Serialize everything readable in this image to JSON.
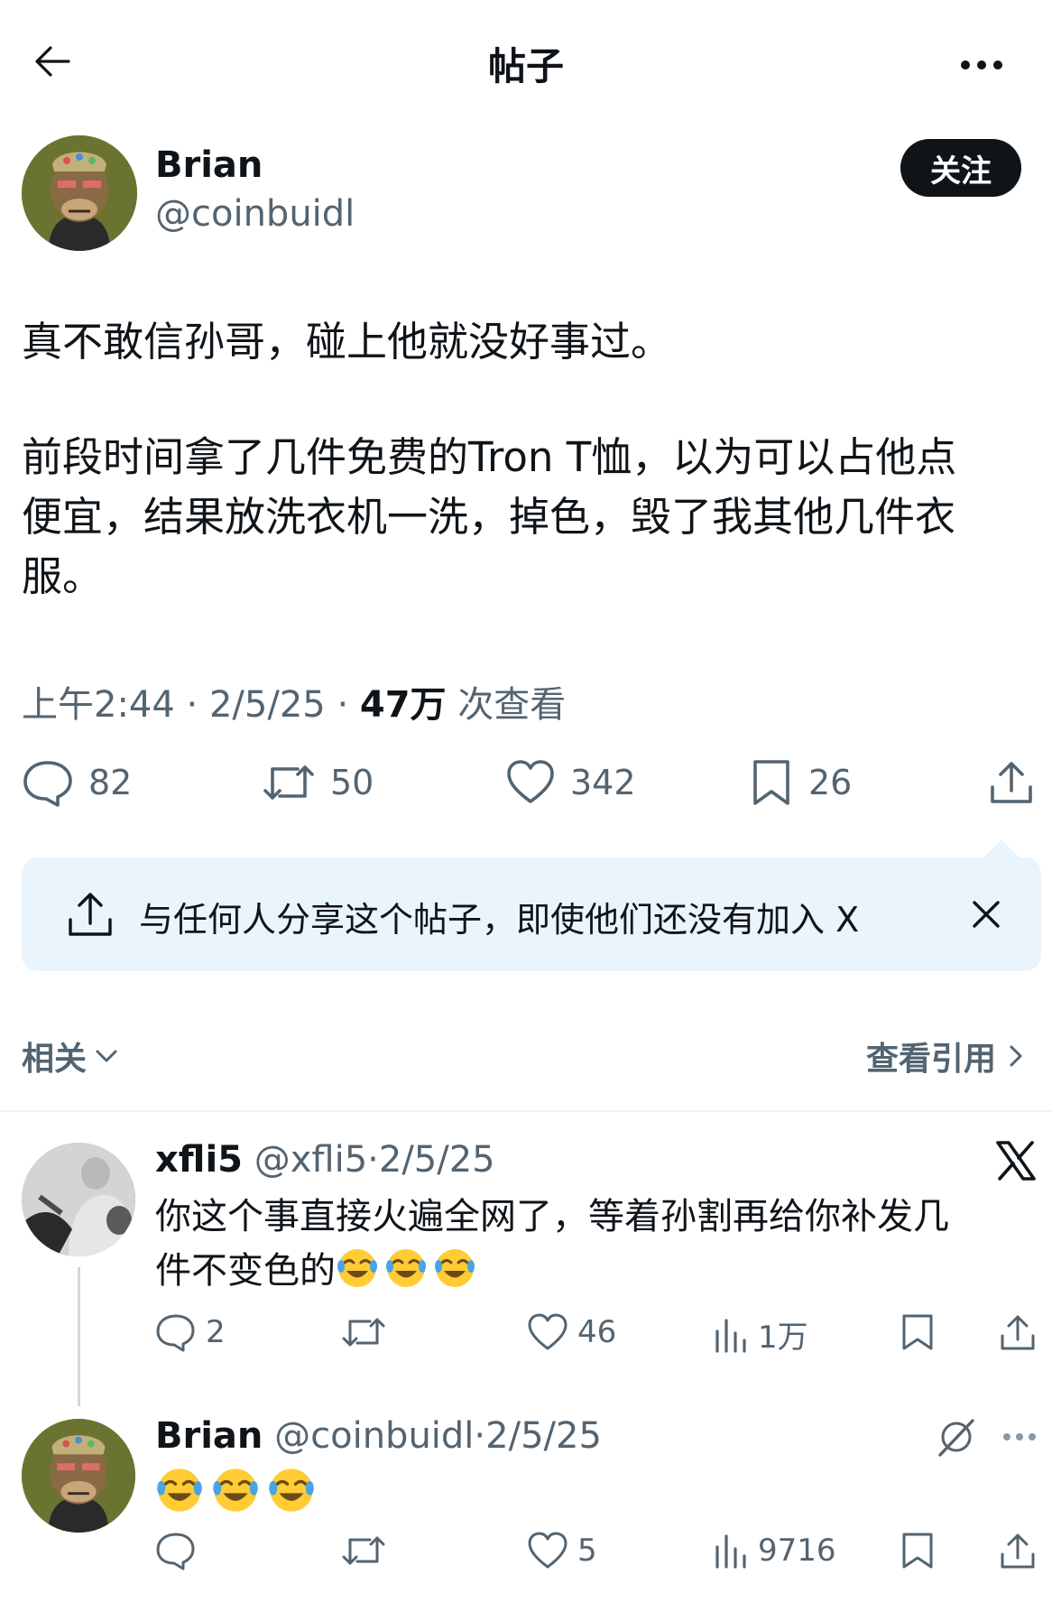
{
  "header": {
    "title": "帖子"
  },
  "post": {
    "author_name": "Brian",
    "author_handle": "@coinbuidl",
    "follow_label": "关注",
    "text_line1": "真不敢信孙哥，碰上他就没好事过。",
    "text_line2": "前段时间拿了几件免费的Tron T恤，以为可以占他点",
    "text_line3": "便宜，结果放洗衣机一洗，掉色，毁了我其他几件衣",
    "text_line4": "服。",
    "time": "上午2:44",
    "date": "2/5/25",
    "views_count": "47万",
    "views_label": "次查看",
    "dot": "·",
    "stats": {
      "replies": "82",
      "reposts": "50",
      "likes": "342",
      "bookmarks": "26"
    }
  },
  "share_banner": {
    "text": "与任何人分享这个帖子，即使他们还没有加入 X"
  },
  "related": {
    "label": "相关",
    "quotes_label": "查看引用"
  },
  "replies": [
    {
      "name": "xfli5",
      "handle": "@xfli5",
      "date": "2/5/25",
      "text_line1": "你这个事直接火遍全网了，等着孙割再给你补发几",
      "text_line2": "件不变色的",
      "emoji_count": 3,
      "stats": {
        "replies": "2",
        "reposts": "",
        "likes": "46",
        "views": "1万"
      }
    },
    {
      "name": "Brian",
      "handle": "@coinbuidl",
      "date": "2/5/25",
      "emoji_count": 3,
      "stats": {
        "replies": "",
        "reposts": "",
        "likes": "5",
        "views": "9716"
      }
    }
  ],
  "icons": {
    "back": "arrow-left-icon",
    "more": "more-horizontal-icon",
    "reply": "speech-bubble-icon",
    "repost": "repost-icon",
    "like": "heart-icon",
    "bookmark": "bookmark-icon",
    "share": "share-icon",
    "views": "bar-chart-icon",
    "close": "close-icon",
    "x_logo": "x-logo-icon",
    "grok": "grok-icon"
  },
  "colors": {
    "text": "#0f1419",
    "secondary": "#536471",
    "banner_bg": "#eaf4fc",
    "divider": "#eff3f4"
  }
}
